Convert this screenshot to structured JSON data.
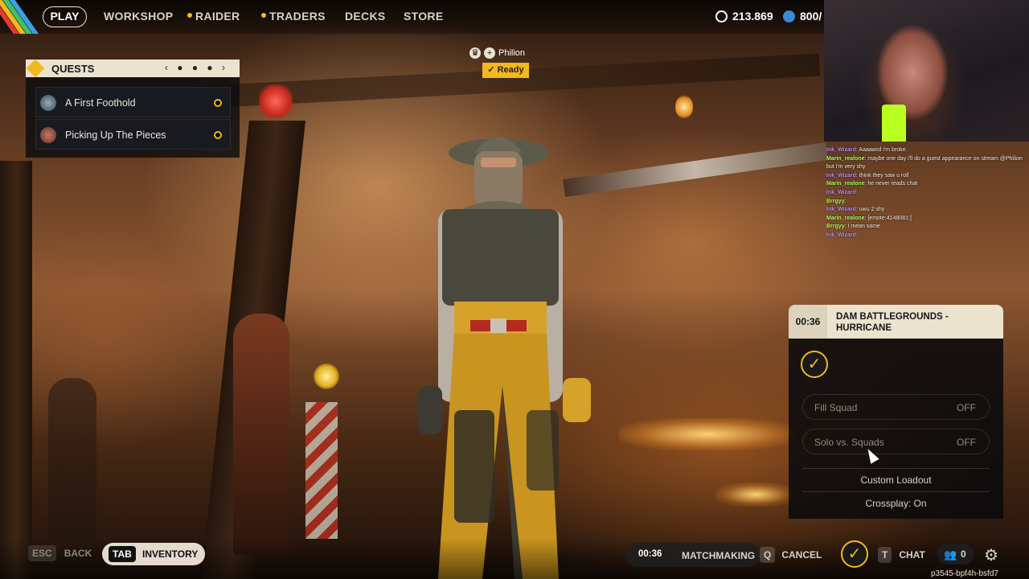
{
  "nav": {
    "items": [
      {
        "label": "PLAY",
        "active": true
      },
      {
        "label": "WORKSHOP"
      },
      {
        "label": "RAIDER",
        "dot": true
      },
      {
        "label": "TRADERS",
        "dot": true
      },
      {
        "label": "DECKS"
      },
      {
        "label": "STORE"
      }
    ],
    "currency": "213.869",
    "credits": "800/"
  },
  "quests": {
    "title": "QUESTS",
    "pager": "‹ ● ● ● ›",
    "items": [
      {
        "name": "A First Foothold"
      },
      {
        "name": "Picking Up The Pieces"
      }
    ]
  },
  "player": {
    "name": "Philion",
    "status": "✓ Ready"
  },
  "chat": {
    "lines": [
      {
        "user": "Ink_Wizard",
        "text": "Aaaaand i'm broke.",
        "color": "u1"
      },
      {
        "user": "Marin_realone",
        "text": "maybe one day i'll do a guest appearance on stream @Philion",
        "color": "u2"
      },
      {
        "user": "",
        "text": "but i'm very shy",
        "color": "u2"
      },
      {
        "user": "Ink_Wizard",
        "text": "think they saw u roll",
        "color": "u1"
      },
      {
        "user": "Marin_realone",
        "text": "he never reads chat",
        "color": "u2"
      },
      {
        "user": "Ink_Wizard",
        "text": "",
        "color": "u1"
      },
      {
        "user": "Brrgyy",
        "text": "",
        "color": "u2"
      },
      {
        "user": "Ink_Wizard",
        "text": "uwu 2 shy",
        "color": "u1"
      },
      {
        "user": "Marin_realone",
        "text": "[emote:4148081:]",
        "color": "u2"
      },
      {
        "user": "Brrgyy",
        "text": "I mean same",
        "color": "u2"
      },
      {
        "user": "Ink_Wizard",
        "text": "",
        "color": "u1"
      }
    ]
  },
  "matchmaking": {
    "timer": "00:36",
    "map": "DAM BATTLEGROUNDS - HURRICANE",
    "badge_icon": "ready-check-icon",
    "fill_squad": {
      "label": "Fill Squad",
      "value": "OFF"
    },
    "solo_vs_squads": {
      "label": "Solo vs. Squads",
      "value": "OFF"
    },
    "custom_loadout": "Custom Loadout",
    "crossplay": "Crossplay: On"
  },
  "bottom": {
    "back_key": "ESC",
    "back_label": "BACK",
    "inventory_key": "TAB",
    "inventory_label": "INVENTORY",
    "mm_timer": "00:36",
    "mm_label": "MATCHMAKING",
    "cancel_key": "Q",
    "cancel_label": "CANCEL",
    "chat_key": "T",
    "chat_label": "CHAT",
    "friends_count": "0",
    "session_id": "p3545-bpf4h-bsfd7"
  },
  "colors": {
    "accent": "#f2b81f",
    "panel_header": "#ece3cf"
  }
}
